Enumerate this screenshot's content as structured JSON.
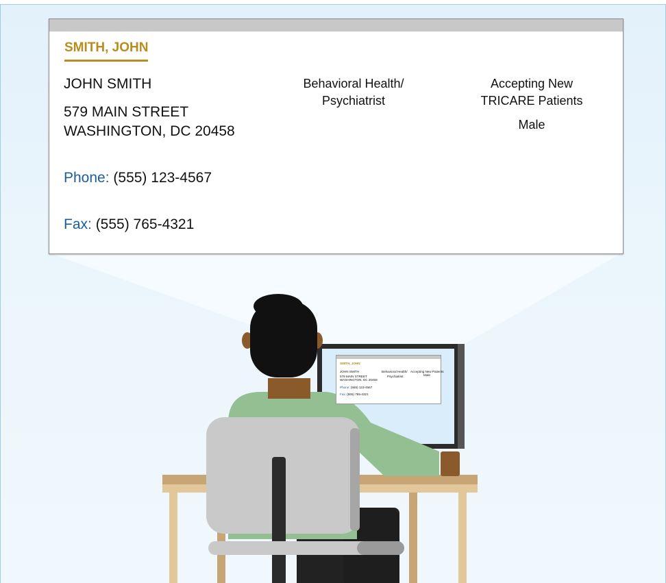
{
  "card": {
    "title": "SMITH, JOHN",
    "name": "JOHN SMITH",
    "address_line1": "579 MAIN STREET",
    "address_line2": "WASHINGTON, DC 20458",
    "phone_label": "Phone:",
    "phone": "(555) 123-4567",
    "fax_label": "Fax:",
    "fax": "(555) 765-4321",
    "specialty_line1": "Behavioral Health/",
    "specialty_line2": "Psychiatrist",
    "status_line1": "Accepting New",
    "status_line2": "TRICARE Patients",
    "gender": "Male"
  },
  "mini_card": {
    "title": "SMITH, JOHN",
    "name": "JOHN SMITH",
    "address_line1": "579 MAIN STREET",
    "address_line2": "WASHINGTON, DC 20458",
    "specialty_line1": "Behavioral Health/",
    "specialty_line2": "Psychiatrist",
    "status": "Accepting New Patients",
    "gender": "Male",
    "phone_label": "Phone:",
    "phone": "(555) 123-4567",
    "fax_label": "Fax:",
    "fax": "(555) 765-4321"
  },
  "colors": {
    "title_gold": "#b88d1d",
    "label_blue": "#1c5c9a",
    "background": "#e3f1fb",
    "shirt": "#93bf93",
    "chair": "#c9c9c9",
    "desk": "#c7a574"
  }
}
